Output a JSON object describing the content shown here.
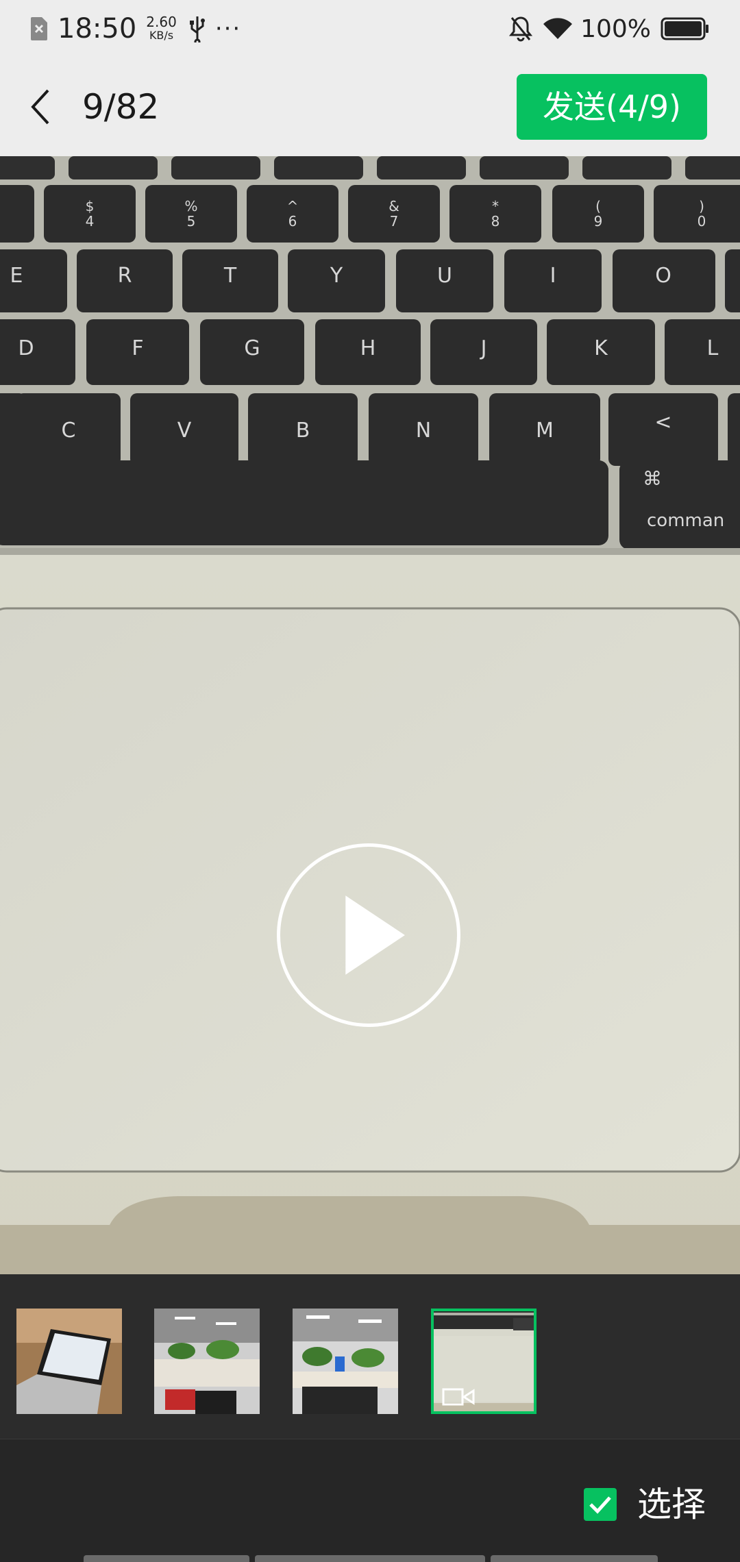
{
  "status_bar": {
    "time": "18:50",
    "speed_value": "2.60",
    "speed_unit": "KB/s",
    "more": "···",
    "battery_percent": "100%",
    "icons": [
      "sim-icon",
      "usb-icon",
      "bell-off-icon",
      "wifi-icon",
      "battery-icon"
    ]
  },
  "header": {
    "counter": "9/82",
    "send_label": "发送(4/9)"
  },
  "preview": {
    "media_type": "video",
    "keyboard_keys": {
      "number_row": [
        "$\n4",
        "%\n5",
        "^\n6",
        "&\n7",
        "*\n8",
        "(\n9",
        ")\n0"
      ],
      "top_row": [
        "E",
        "R",
        "T",
        "Y",
        "U",
        "I",
        "O"
      ],
      "home_row": [
        "D",
        "F",
        "G",
        "H",
        "J",
        "K",
        "L"
      ],
      "bottom_row": [
        "C",
        "V",
        "B",
        "N",
        "M",
        "<"
      ],
      "command_symbol": "⌘",
      "command_label": "comman"
    }
  },
  "thumbnails": [
    {
      "kind": "photo",
      "selected": false
    },
    {
      "kind": "photo",
      "selected": false
    },
    {
      "kind": "photo",
      "selected": false
    },
    {
      "kind": "video",
      "selected": true
    }
  ],
  "footer": {
    "select_label": "选择",
    "select_checked": true
  },
  "colors": {
    "accent": "#07c160",
    "bar_background": "#ededed",
    "dark_background": "#262626"
  }
}
